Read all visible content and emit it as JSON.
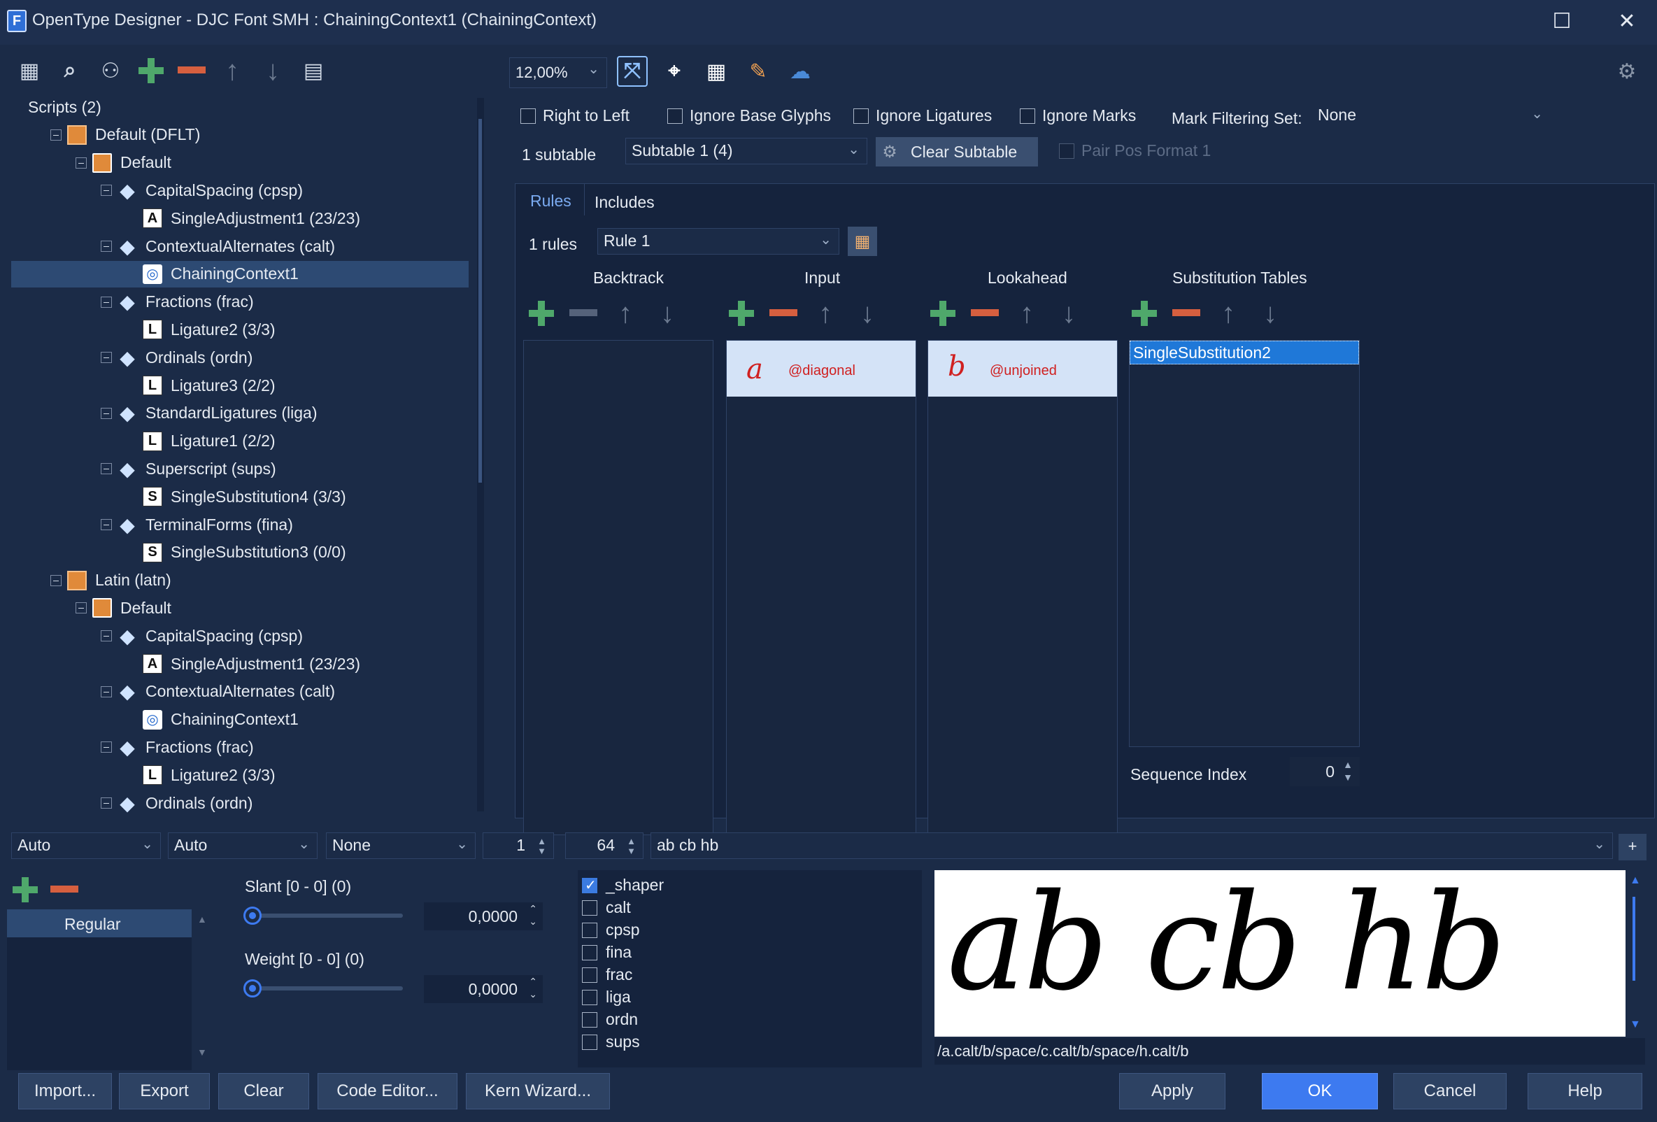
{
  "window": {
    "title": "OpenType Designer - DJC Font SMH : ChainingContext1 (ChainingContext)",
    "maximize": "☐",
    "close": "✕"
  },
  "tree": [
    {
      "label": "Scripts (2)",
      "depth": 0,
      "type": "root"
    },
    {
      "label": "Default (DFLT)",
      "depth": 1,
      "type": "script"
    },
    {
      "label": "Default",
      "depth": 2,
      "type": "lang"
    },
    {
      "label": "CapitalSpacing (cpsp)",
      "depth": 3,
      "type": "feat"
    },
    {
      "label": "SingleAdjustment1 (23/23)",
      "depth": 4,
      "type": "look",
      "glyph": "A"
    },
    {
      "label": "ContextualAlternates (calt)",
      "depth": 3,
      "type": "feat"
    },
    {
      "label": "ChainingContext1",
      "depth": 4,
      "type": "chain",
      "selected": true
    },
    {
      "label": "Fractions (frac)",
      "depth": 3,
      "type": "feat"
    },
    {
      "label": "Ligature2 (3/3)",
      "depth": 4,
      "type": "look",
      "glyph": "L"
    },
    {
      "label": "Ordinals (ordn)",
      "depth": 3,
      "type": "feat"
    },
    {
      "label": "Ligature3 (2/2)",
      "depth": 4,
      "type": "look",
      "glyph": "L"
    },
    {
      "label": "StandardLigatures (liga)",
      "depth": 3,
      "type": "feat"
    },
    {
      "label": "Ligature1 (2/2)",
      "depth": 4,
      "type": "look",
      "glyph": "L"
    },
    {
      "label": "Superscript (sups)",
      "depth": 3,
      "type": "feat"
    },
    {
      "label": "SingleSubstitution4 (3/3)",
      "depth": 4,
      "type": "look",
      "glyph": "S"
    },
    {
      "label": "TerminalForms (fina)",
      "depth": 3,
      "type": "feat"
    },
    {
      "label": "SingleSubstitution3 (0/0)",
      "depth": 4,
      "type": "look",
      "glyph": "S"
    },
    {
      "label": "Latin (latn)",
      "depth": 1,
      "type": "script"
    },
    {
      "label": "Default",
      "depth": 2,
      "type": "lang"
    },
    {
      "label": "CapitalSpacing (cpsp)",
      "depth": 3,
      "type": "feat"
    },
    {
      "label": "SingleAdjustment1 (23/23)",
      "depth": 4,
      "type": "look",
      "glyph": "A"
    },
    {
      "label": "ContextualAlternates (calt)",
      "depth": 3,
      "type": "feat"
    },
    {
      "label": "ChainingContext1",
      "depth": 4,
      "type": "chain"
    },
    {
      "label": "Fractions (frac)",
      "depth": 3,
      "type": "feat"
    },
    {
      "label": "Ligature2 (3/3)",
      "depth": 4,
      "type": "look",
      "glyph": "L"
    },
    {
      "label": "Ordinals (ordn)",
      "depth": 3,
      "type": "feat"
    }
  ],
  "toolbar": {
    "zoom": "12,00%"
  },
  "options": {
    "right_to_left": "Right to Left",
    "ignore_base": "Ignore Base Glyphs",
    "ignore_lig": "Ignore Ligatures",
    "ignore_marks": "Ignore Marks",
    "mark_filter_label": "Mark Filtering Set:",
    "mark_filter_value": "None",
    "subtable_count": "1 subtable",
    "subtable_value": "Subtable 1 (4)",
    "clear_subtable": "Clear Subtable",
    "pair_pos": "Pair Pos Format 1"
  },
  "tabs": {
    "rules": "Rules",
    "includes": "Includes"
  },
  "rules": {
    "count": "1 rules",
    "value": "Rule 1"
  },
  "columns": {
    "backtrack": "Backtrack",
    "input": "Input",
    "lookahead": "Lookahead",
    "subst": "Substitution Tables"
  },
  "input_item": {
    "glyph": "a",
    "class": "@diagonal"
  },
  "lookahead_item": {
    "glyph": "b",
    "class": "@unjoined"
  },
  "subst_item": "SingleSubstitution2",
  "seq": {
    "label": "Sequence Index",
    "value": "0"
  },
  "preview_bar": {
    "dd1": "Auto",
    "dd2": "Auto",
    "dd3": "None",
    "n1": "1",
    "n2": "64",
    "text": "ab cb hb",
    "plus": "+"
  },
  "axes": {
    "master": "Regular",
    "slant_label": "Slant [0 - 0] (0)",
    "slant_value": "0,0000",
    "weight_label": "Weight [0 - 0] (0)",
    "weight_value": "0,0000"
  },
  "features": [
    {
      "tag": "_shaper",
      "on": true
    },
    {
      "tag": "calt",
      "on": false
    },
    {
      "tag": "cpsp",
      "on": false
    },
    {
      "tag": "fina",
      "on": false
    },
    {
      "tag": "frac",
      "on": false
    },
    {
      "tag": "liga",
      "on": false
    },
    {
      "tag": "ordn",
      "on": false
    },
    {
      "tag": "sups",
      "on": false
    }
  ],
  "preview": {
    "sample": "ab cb hb",
    "glyphs": "/a.calt/b/space/c.calt/b/space/h.calt/b"
  },
  "buttons": {
    "import": "Import...",
    "export": "Export",
    "clear": "Clear",
    "code_editor": "Code Editor...",
    "kern_wizard": "Kern Wizard...",
    "apply": "Apply",
    "ok": "OK",
    "cancel": "Cancel",
    "help": "Help"
  }
}
